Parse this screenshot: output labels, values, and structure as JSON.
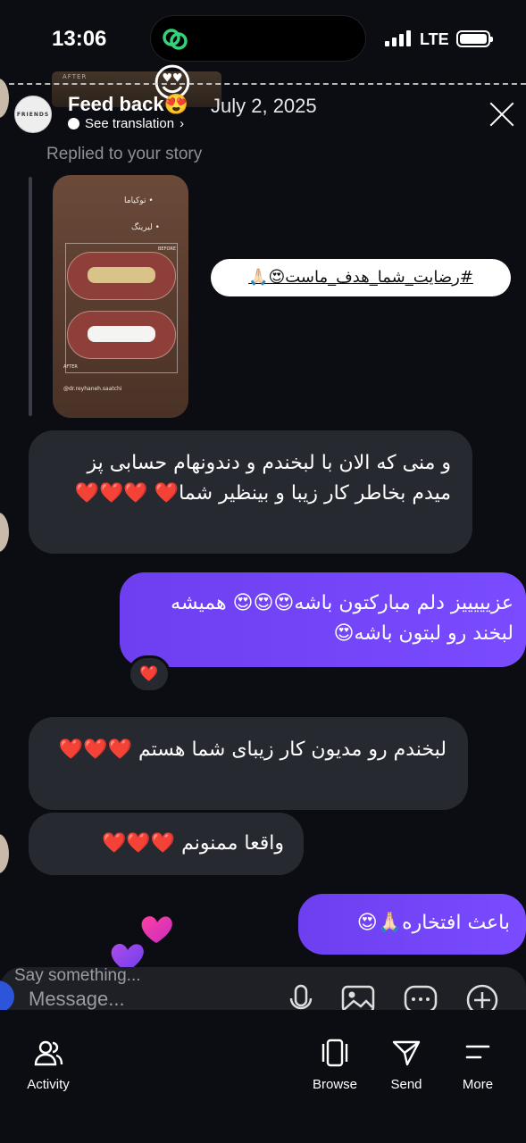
{
  "status_bar": {
    "time": "13:06",
    "network": "LTE"
  },
  "header": {
    "title": "Feed back",
    "title_emoji": "😍",
    "date": "July 2, 2025",
    "see_translation": "See translation",
    "avatar_text": "FRIENDS",
    "story_overlay_label": "AFTER",
    "story_overlay_emoji": "😍"
  },
  "story_reply": {
    "label": "Replied to your story",
    "thumb_text_1": "توکیاما •",
    "thumb_text_2": "لیرینگ •",
    "thumb_before": "BEFORE",
    "thumb_after": "AFTER",
    "thumb_handle": "@dr.reyhaneh.saatchi",
    "hashtag": "#رضایت_شما_هدف_ماست😍🙏🏻"
  },
  "messages": [
    {
      "direction": "in",
      "text": "و منی که الان با لبخندم و دندونهام حسابی پز میدم بخاطر کار زیبا و بینظیر شما❤️ ❤️❤️❤️"
    },
    {
      "direction": "out",
      "text": "عزیییییز دلم مبارکتون باشه😍😍😍 همیشه لبخند رو لبتون باشه😍",
      "reaction": "❤️"
    },
    {
      "direction": "in",
      "text": "لبخندم رو مدیون کار زیبای شما هستم ❤️❤️❤️"
    },
    {
      "direction": "in",
      "text": "واقعا ممنونم ❤️❤️❤️"
    },
    {
      "direction": "out",
      "text": "باعث افتخاره🙏🏻😍"
    }
  ],
  "composer": {
    "say_something": "Say something...",
    "placeholder": "Message..."
  },
  "nav": {
    "activity": "Activity",
    "browse": "Browse",
    "send": "Send",
    "more": "More"
  },
  "colors": {
    "background": "#0b0d13",
    "incoming_bubble": "#262930",
    "outgoing_bubble": "#7a4bff"
  }
}
